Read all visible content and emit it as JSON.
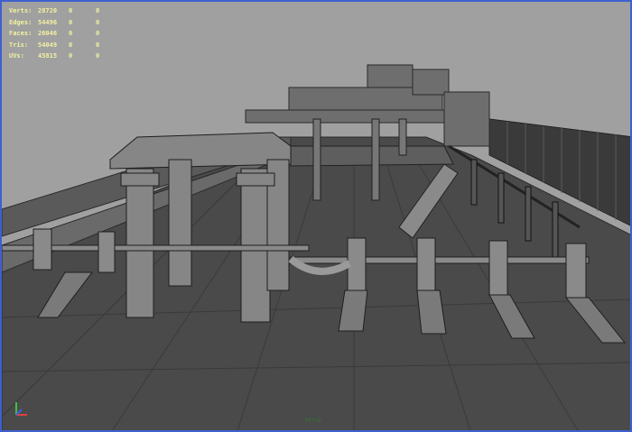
{
  "hud": {
    "rows": [
      {
        "label": "Verts:",
        "value": "28720",
        "sel1": "0",
        "sel2": "0"
      },
      {
        "label": "Edges:",
        "value": "54496",
        "sel1": "0",
        "sel2": "0"
      },
      {
        "label": "Faces:",
        "value": "26046",
        "sel1": "0",
        "sel2": "0"
      },
      {
        "label": "Tris:",
        "value": "54049",
        "sel1": "0",
        "sel2": "0"
      },
      {
        "label": "UVs:",
        "value": "45815",
        "sel1": "0",
        "sel2": "0"
      }
    ]
  },
  "camera_label": "persp",
  "colors": {
    "viewport_border": "#3f5fd0",
    "background": "#a0a0a0",
    "hud_text": "#f2f2a0"
  },
  "icons": {
    "axis": "axis-gizmo-icon"
  }
}
